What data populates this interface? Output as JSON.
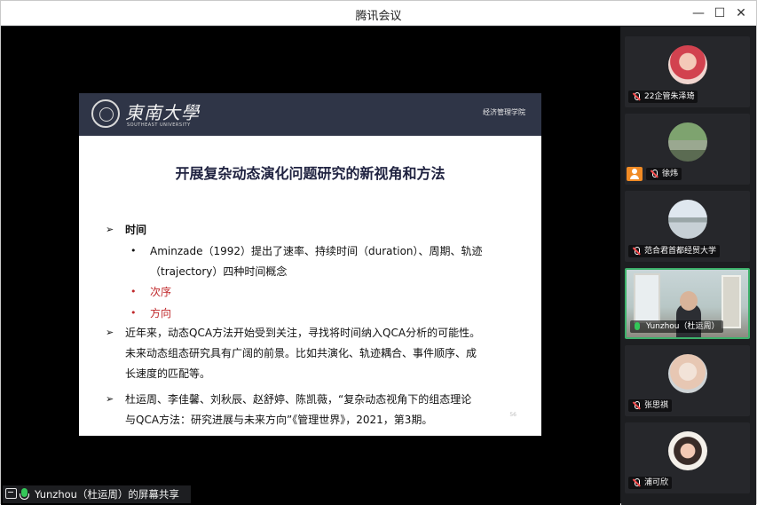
{
  "window": {
    "title": "腾讯会议",
    "minimize": "—",
    "maximize": "☐",
    "close": "✕"
  },
  "slide": {
    "logo_text": "東南大學",
    "logo_sub": "SOUTHEAST UNIVERSITY",
    "school": "经济管理学院",
    "title": "开展复杂动态演化问题研究的新视角和方法",
    "lines": [
      {
        "bullet": "➢",
        "text": "时间"
      },
      {
        "bullet": "•",
        "text": "Aminzade（1992）提出了速率、持续时间（duration）、周期、轨迹"
      },
      {
        "text": "（trajectory）四种时间概念"
      },
      {
        "bullet": "•",
        "text": "次序"
      },
      {
        "bullet": "•",
        "text": "方向"
      },
      {
        "bullet": "➢",
        "text": "近年来，动态QCA方法开始受到关注，寻找将时间纳入QCA分析的可能性。"
      },
      {
        "text": "未来动态组态研究具有广阔的前景。比如共演化、轨迹耦合、事件顺序、成"
      },
      {
        "text": "长速度的匹配等。"
      },
      {
        "bullet": "➢",
        "text": "杜运周、李佳馨、刘秋辰、赵舒婷、陈凯薇，“复杂动态视角下的组态理论"
      },
      {
        "text": "与QCA方法：研究进展与未来方向”《管理世界》，2021，第3期。"
      }
    ],
    "page": "56"
  },
  "share_status": "Yunzhou（杜运周）的屏幕共享",
  "participants": [
    {
      "name": "22企管朱泽琦",
      "mic": "muted"
    },
    {
      "name": "徐炜",
      "mic": "muted",
      "host": true
    },
    {
      "name": "范合君首都经贸大学",
      "mic": "muted"
    },
    {
      "name": "Yunzhou（杜运周）",
      "mic": "speaking"
    },
    {
      "name": "张思祺",
      "mic": "muted"
    },
    {
      "name": "浦可欣",
      "mic": "muted"
    }
  ],
  "colors": {
    "accent_green": "#3db16b",
    "slide_header": "#2f3547",
    "slide_red": "#c0282b"
  }
}
